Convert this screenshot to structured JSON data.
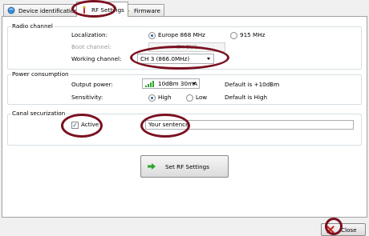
{
  "tabs": [
    {
      "label": "Device identification",
      "icon": "device-icon"
    },
    {
      "label": "RF Settings",
      "icon": "antenna-icon"
    },
    {
      "label": "Firmware",
      "icon": "firmware-icon"
    }
  ],
  "radio_channel": {
    "title": "Radio channel",
    "localization_label": "Localization:",
    "option_eu": "Europe 868 MHz",
    "option_us": "915 MHz",
    "boot_channel_label": "Boot channel:",
    "boot_channel_value": "CH EU1",
    "working_channel_label": "Working channel:",
    "working_channel_value": "CH 3  (866.0MHz)"
  },
  "power": {
    "title": "Power consumption",
    "output_power_label": "Output power:",
    "output_power_value": "10dBm 30mA",
    "output_power_default": "Default is +10dBm",
    "sensitivity_label": "Sensitivity:",
    "sensitivity_high": "High",
    "sensitivity_low": "Low",
    "sensitivity_default": "Default is High"
  },
  "canal": {
    "title": "Canal securization",
    "active_label": "Active",
    "active_checked": true,
    "sentence_value": "Your sentence"
  },
  "actions": {
    "set_rf_label": "Set RF Settings",
    "close_label": "Close"
  },
  "colors": {
    "annotation": "#7a1020",
    "accent": "#2a5fa8",
    "signal": "#2aa52a"
  }
}
